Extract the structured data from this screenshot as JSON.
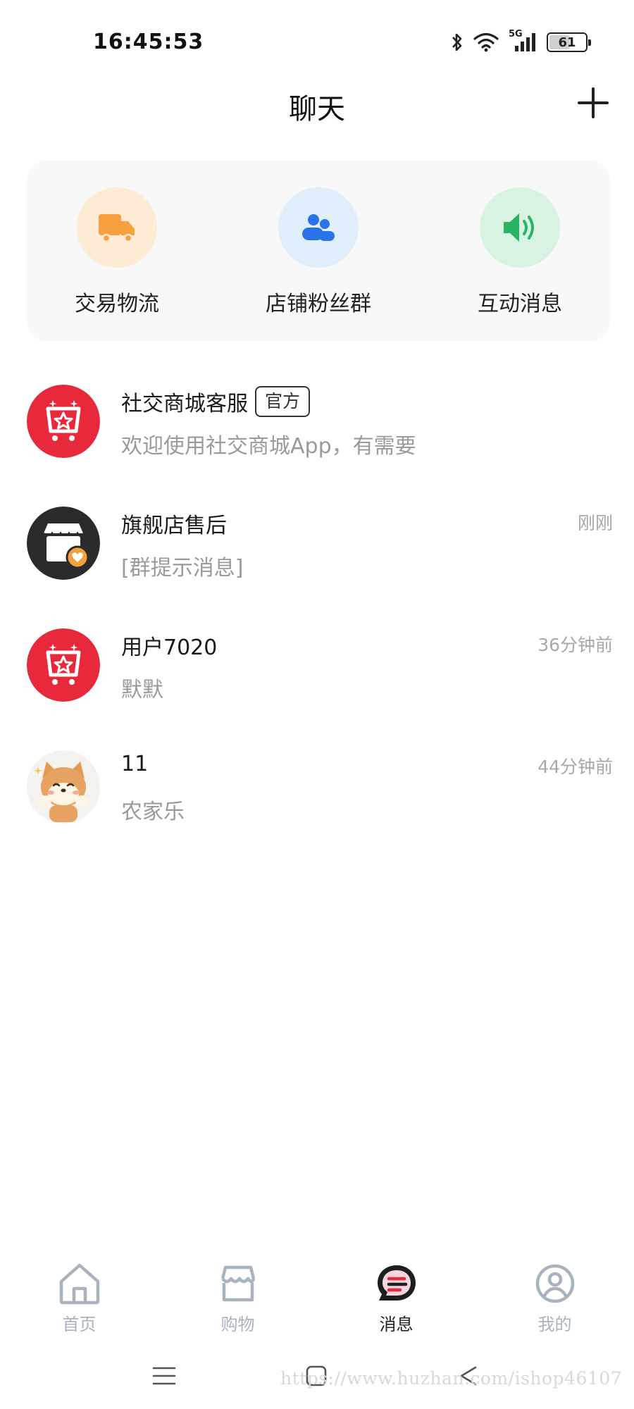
{
  "status_bar": {
    "time": "16:45:53",
    "network": "5G",
    "battery": "61",
    "battery_level": 0.61
  },
  "header": {
    "title": "聊天",
    "add_icon": "plus-icon"
  },
  "quick_actions": [
    {
      "label": "交易物流",
      "icon": "truck-icon",
      "bg": "#fdebd3",
      "color": "#f6a040"
    },
    {
      "label": "店铺粉丝群",
      "icon": "group-icon",
      "bg": "#e1eefc",
      "color": "#2a72e8"
    },
    {
      "label": "互动消息",
      "icon": "speaker-icon",
      "bg": "#d9f3e2",
      "color": "#28b463"
    }
  ],
  "chats": [
    {
      "name": "社交商城客服",
      "badge": "官方",
      "preview": "欢迎使用社交商城App，有需要",
      "time": "",
      "avatar": "shop-cart-avatar"
    },
    {
      "name": "旗舰店售后",
      "badge": "",
      "preview": "[群提示消息]",
      "time": "刚刚",
      "avatar": "store-avatar"
    },
    {
      "name": "用户7020",
      "badge": "",
      "preview": "默默",
      "time": "36分钟前",
      "avatar": "shop-cart-avatar"
    },
    {
      "name": "11",
      "badge": "",
      "preview": "农家乐",
      "time": "44分钟前",
      "avatar": "shiba-dog-avatar"
    }
  ],
  "bottom_nav": [
    {
      "label": "首页",
      "icon": "home-icon",
      "active": false
    },
    {
      "label": "购物",
      "icon": "shop-icon",
      "active": false
    },
    {
      "label": "消息",
      "icon": "message-icon",
      "active": true
    },
    {
      "label": "我的",
      "icon": "profile-icon",
      "active": false
    }
  ],
  "watermark": "https://www.huzhan.com/ishop46107",
  "colors": {
    "brand_red": "#e8293b",
    "nav_inactive": "#a9b3c0"
  }
}
